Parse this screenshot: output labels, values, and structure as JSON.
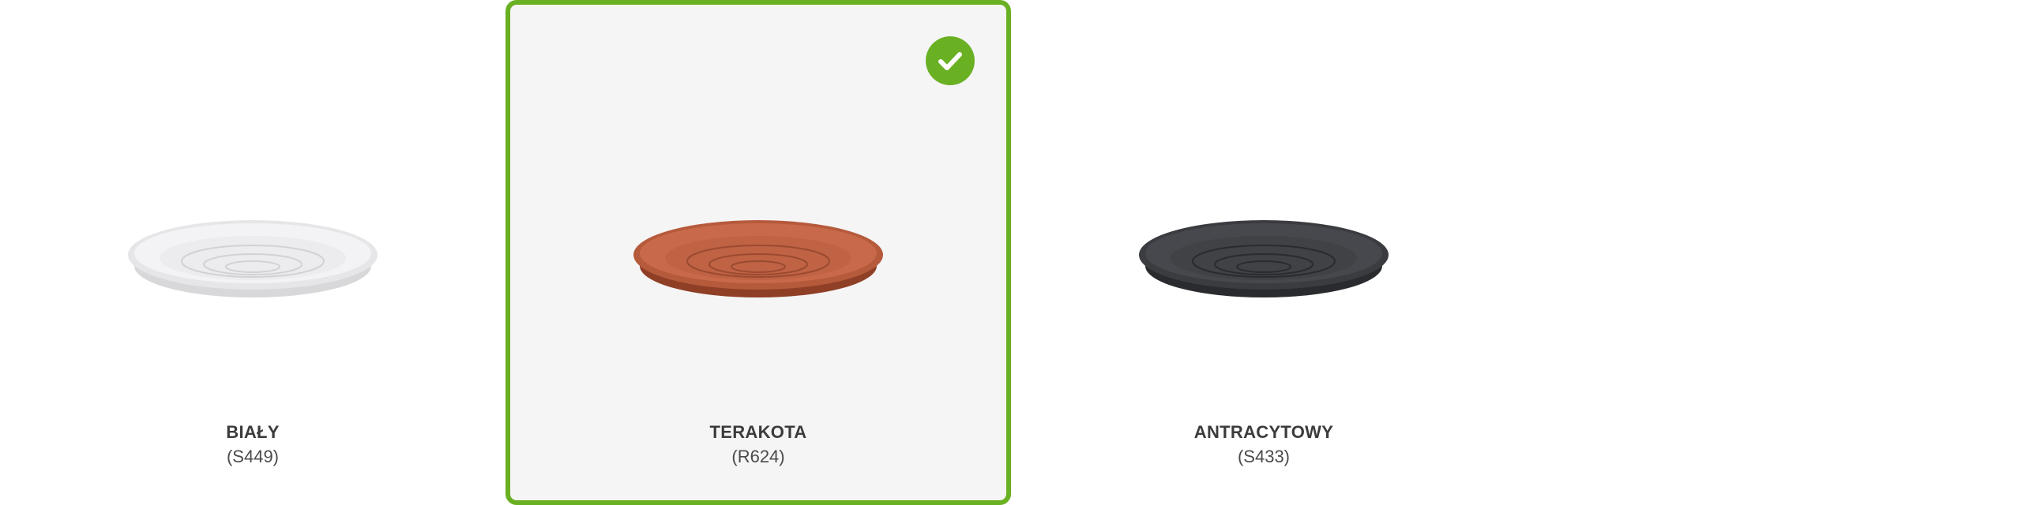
{
  "colors": {
    "accent": "#6ab023",
    "selected_background": "#f5f5f6"
  },
  "options": [
    {
      "name": "BIAŁY",
      "code": "(S449)",
      "fill": "#f2f2f4",
      "rim": "#dcdcde",
      "groove": "#c9c9cc",
      "selected": false
    },
    {
      "name": "TERAKOTA",
      "code": "(R624)",
      "fill": "#c86a4a",
      "rim": "#b65a3c",
      "groove": "#9a4a30",
      "selected": true
    },
    {
      "name": "ANTRACYTOWY",
      "code": "(S433)",
      "fill": "#44464b",
      "rim": "#36383c",
      "groove": "#2a2b2e",
      "selected": false
    }
  ],
  "selected_indicator": {
    "icon": "checkmark-icon"
  }
}
